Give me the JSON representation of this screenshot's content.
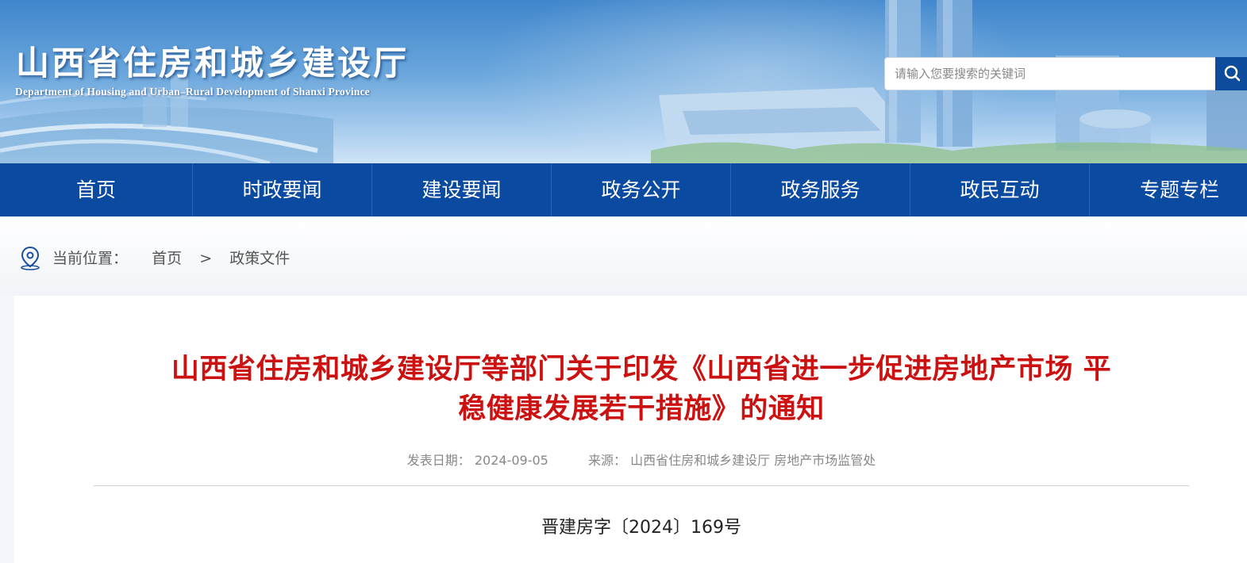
{
  "header": {
    "title": "山西省住房和城乡建设厅",
    "subtitle": "Department of Housing and Urban–Rural Development of Shanxi Province",
    "search": {
      "placeholder": "请输入您要搜索的关键词",
      "value": ""
    }
  },
  "nav": {
    "items": [
      {
        "label": "首页"
      },
      {
        "label": "时政要闻"
      },
      {
        "label": "建设要闻"
      },
      {
        "label": "政务公开"
      },
      {
        "label": "政务服务"
      },
      {
        "label": "政民互动"
      },
      {
        "label": "专题专栏"
      }
    ]
  },
  "breadcrumb": {
    "prefix": "当前位置：",
    "home": "首页",
    "separator": ">",
    "current": "政策文件"
  },
  "article": {
    "title_line1": "山西省住房和城乡建设厅等部门关于印发《山西省进一步促进房地产市场 平",
    "title_line2": "稳健康发展若干措施》的通知",
    "date_label": "发表日期：",
    "date": "2024-09-05",
    "source_label": "来源：",
    "source": "山西省住房和城乡建设厅 房地产市场监管处",
    "doc_number": "晋建房字〔2024〕169号"
  },
  "colors": {
    "nav_bg": "#0b4aa1",
    "title_red": "#cc1111",
    "search_button": "#0d4c9c"
  },
  "icons": {
    "search": "search-icon",
    "location": "location-pin-icon"
  }
}
